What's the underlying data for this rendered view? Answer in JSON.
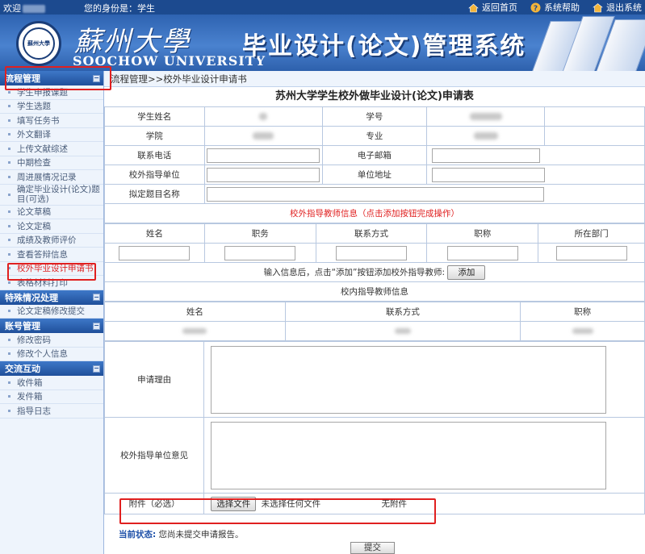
{
  "topbar": {
    "welcome": "欢迎",
    "identity": "您的身份是：学生",
    "nav": [
      {
        "label": "返回首页",
        "icon": "home-icon"
      },
      {
        "label": "系统帮助",
        "icon": "help-icon"
      },
      {
        "label": "退出系统",
        "icon": "logout-icon"
      }
    ]
  },
  "banner": {
    "university_cn": "蘇州大學",
    "university_en": "SOOCHOW UNIVERSITY",
    "system_title": "毕业设计(论文)管理系统",
    "seal_text": "蘇州大學"
  },
  "sidebar": {
    "sections": [
      {
        "title": "流程管理",
        "items": [
          "学生申报课题",
          "学生选题",
          "填写任务书",
          "外文翻译",
          "上传文献综述",
          "中期检查",
          "周进展情况记录",
          "确定毕业设计(论文)题目(可选)",
          "论文草稿",
          "论文定稿",
          "成绩及教师评价",
          "查看答辩信息",
          "校外毕业设计申请书",
          "表格材料打印"
        ]
      },
      {
        "title": "特殊情况处理",
        "items": [
          "论文定稿修改提交"
        ]
      },
      {
        "title": "账号管理",
        "items": [
          "修改密码",
          "修改个人信息"
        ]
      },
      {
        "title": "交流互动",
        "items": [
          "收件箱",
          "发件箱",
          "指导日志"
        ]
      }
    ],
    "active_item": "校外毕业设计申请书"
  },
  "breadcrumb": "流程管理>>校外毕业设计申请书",
  "form": {
    "title": "苏州大学学生校外做毕业设计(论文)申请表",
    "labels": {
      "student_name": "学生姓名",
      "student_id": "学号",
      "college": "学院",
      "major": "专业",
      "phone": "联系电话",
      "email": "电子邮箱",
      "ext_unit": "校外指导单位",
      "unit_address": "单位地址",
      "proposed_title": "拟定题目名称"
    },
    "ext_teacher_note": "校外指导教师信息（点击添加按钮完成操作）",
    "ext_teacher_cols": [
      "姓名",
      "职务",
      "联系方式",
      "职称",
      "所在部门"
    ],
    "add_hint": "输入信息后，点击“添加”按钮添加校外指导教师:",
    "add_button": "添加",
    "int_teacher_title": "校内指导教师信息",
    "int_teacher_cols": [
      "姓名",
      "联系方式",
      "职称"
    ],
    "reason_label": "申请理由",
    "ext_opinion_label": "校外指导单位意见",
    "attachment_label": "附件（必选）",
    "choose_file_button": "选择文件",
    "no_file_chosen": "未选择任何文件",
    "no_attachment": "无附件"
  },
  "status": {
    "label": "当前状态:",
    "text": "您尚未提交申请报告。"
  },
  "submit_button": "提交",
  "colors": {
    "header_blue": "#1c4a8f",
    "highlight_red": "#e02020",
    "status_blue": "#1c4fa8"
  }
}
